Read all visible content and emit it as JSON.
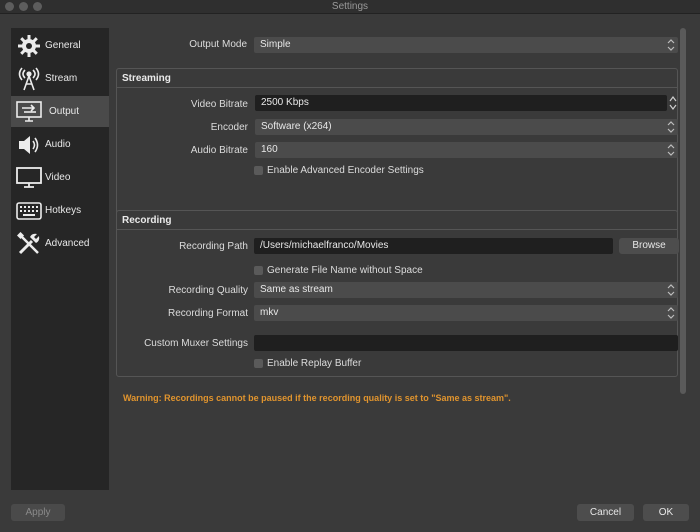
{
  "window": {
    "title": "Settings"
  },
  "sidebar": {
    "items": [
      {
        "label": "General",
        "icon": "gear-icon"
      },
      {
        "label": "Stream",
        "icon": "antenna-icon"
      },
      {
        "label": "Output",
        "icon": "monitor-output-icon"
      },
      {
        "label": "Audio",
        "icon": "speaker-icon"
      },
      {
        "label": "Video",
        "icon": "monitor-icon"
      },
      {
        "label": "Hotkeys",
        "icon": "keyboard-icon"
      },
      {
        "label": "Advanced",
        "icon": "tools-icon"
      }
    ],
    "selected": "Output"
  },
  "output_mode": {
    "label": "Output Mode",
    "value": "Simple"
  },
  "streaming": {
    "title": "Streaming",
    "video_bitrate": {
      "label": "Video Bitrate",
      "value": "2500 Kbps"
    },
    "encoder": {
      "label": "Encoder",
      "value": "Software (x264)"
    },
    "audio_bitrate": {
      "label": "Audio Bitrate",
      "value": "160"
    },
    "advanced_encoder": {
      "label": "Enable Advanced Encoder Settings",
      "checked": false
    }
  },
  "recording": {
    "title": "Recording",
    "path": {
      "label": "Recording Path",
      "value": "/Users/michaelfranco/Movies"
    },
    "browse_label": "Browse",
    "no_space": {
      "label": "Generate File Name without Space",
      "checked": false
    },
    "quality": {
      "label": "Recording Quality",
      "value": "Same as stream"
    },
    "format": {
      "label": "Recording Format",
      "value": "mkv"
    },
    "muxer": {
      "label": "Custom Muxer Settings",
      "value": ""
    },
    "replay_buffer": {
      "label": "Enable Replay Buffer",
      "checked": false
    }
  },
  "warning": "Warning: Recordings cannot be paused if the recording quality is set to \"Same as stream\".",
  "buttons": {
    "apply": "Apply",
    "cancel": "Cancel",
    "ok": "OK"
  },
  "colors": {
    "warning": "#e0942e",
    "selected_item": "#4a4a4a"
  }
}
